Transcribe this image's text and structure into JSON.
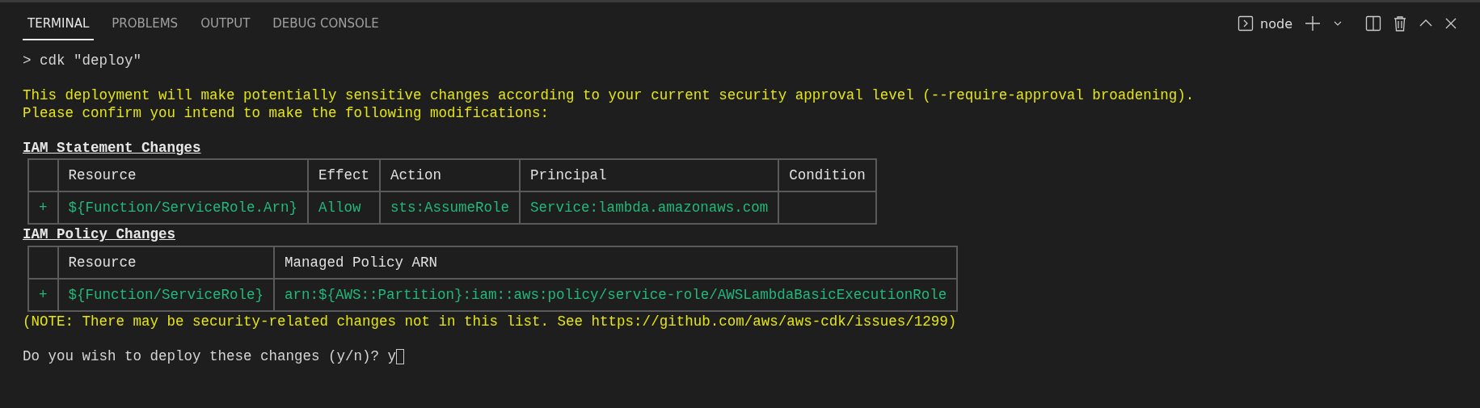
{
  "tabs": [
    {
      "label": "TERMINAL",
      "selected": true
    },
    {
      "label": "PROBLEMS",
      "selected": false
    },
    {
      "label": "OUTPUT",
      "selected": false
    },
    {
      "label": "DEBUG CONSOLE",
      "selected": false
    }
  ],
  "toolbar": {
    "shell": "node"
  },
  "terminal": [
    {
      "kind": "command",
      "text": "> cdk \"deploy\""
    },
    {
      "kind": "blank"
    },
    {
      "kind": "warning",
      "text": "This deployment will make potentially sensitive changes according to your current security approval level (--require-approval broadening)."
    },
    {
      "kind": "warning",
      "text": "Please confirm you intend to make the following modifications:"
    },
    {
      "kind": "blank"
    },
    {
      "kind": "heading",
      "text": "IAM Statement Changes"
    },
    {
      "kind": "table",
      "columns": [
        "Resource",
        "Effect",
        "Action",
        "Principal",
        "Condition"
      ],
      "rows": [
        {
          "marker": "+",
          "cells": [
            "${Function/ServiceRole.Arn}",
            "Allow",
            "sts:AssumeRole",
            "Service:lambda.amazonaws.com",
            ""
          ]
        }
      ]
    },
    {
      "kind": "heading",
      "text": "IAM Policy Changes"
    },
    {
      "kind": "table",
      "columns": [
        "Resource",
        "Managed Policy ARN"
      ],
      "rows": [
        {
          "marker": "+",
          "cells": [
            "${Function/ServiceRole}",
            "arn:${AWS::Partition}:iam::aws:policy/service-role/AWSLambdaBasicExecutionRole"
          ]
        }
      ]
    },
    {
      "kind": "warning",
      "text": "(NOTE: There may be security-related changes not in this list. See https://github.com/aws/aws-cdk/issues/1299)"
    },
    {
      "kind": "blank"
    },
    {
      "kind": "prompt",
      "text": "Do you wish to deploy these changes (y/n)? y"
    }
  ]
}
